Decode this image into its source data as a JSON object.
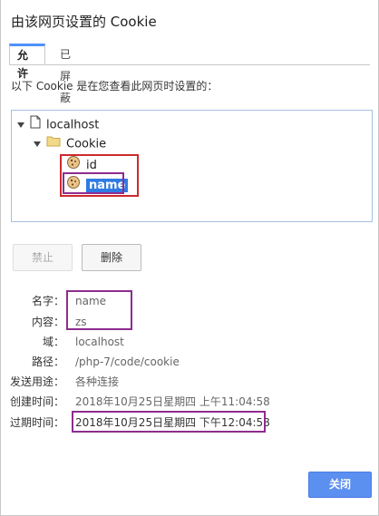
{
  "dialog": {
    "title": "由该网页设置的 Cookie"
  },
  "tabs": [
    {
      "label": "允许",
      "active": true
    },
    {
      "label": "已屏蔽",
      "active": false
    }
  ],
  "description": "以下 Cookie 是在您查看此网页时设置的：",
  "tree": {
    "root": {
      "label": "localhost",
      "icon": "page-icon",
      "expanded": true
    },
    "folder": {
      "label": "Cookie",
      "icon": "folder-icon",
      "expanded": true
    },
    "cookies": [
      {
        "label": "id",
        "icon": "cookie-icon",
        "selected": false
      },
      {
        "label": "name",
        "icon": "cookie-icon",
        "selected": true
      }
    ]
  },
  "buttons": {
    "block": "禁止",
    "delete": "删除",
    "close": "关闭"
  },
  "details": [
    {
      "label": "名字：",
      "value": "name"
    },
    {
      "label": "内容：",
      "value": "zs"
    },
    {
      "label": "域：",
      "value": "localhost"
    },
    {
      "label": "路径：",
      "value": "/php-7/code/cookie"
    },
    {
      "label": "发送用途：",
      "value": "各种连接"
    },
    {
      "label": "创建时间：",
      "value": "2018年10月25日星期四 上午11:04:58"
    },
    {
      "label": "过期时间：",
      "value": "2018年10月25日星期四 下午12:04:58"
    }
  ],
  "colors": {
    "accent": "#2e7ce3",
    "annotation_red": "#cc2b2b",
    "annotation_purple": "#8e2c8e",
    "primary_button": "#5b8ff0"
  }
}
